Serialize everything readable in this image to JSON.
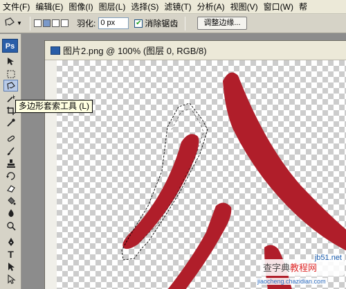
{
  "menubar": {
    "items": [
      "文件(F)",
      "编辑(E)",
      "图像(I)",
      "图层(L)",
      "选择(S)",
      "滤镜(T)",
      "分析(A)",
      "视图(V)",
      "窗口(W)",
      "帮"
    ]
  },
  "options": {
    "feather_label": "羽化:",
    "feather_value": "0 px",
    "antialias_label": "消除锯齿",
    "antialias_checked": true,
    "refine_edge_label": "调整边缘..."
  },
  "toolbox": {
    "logo": "Ps",
    "active_tool": "polygonal-lasso",
    "tools": [
      "move",
      "marquee",
      "polygonal-lasso",
      "quick-selection",
      "crop",
      "eyedropper",
      "healing",
      "brush",
      "clone-stamp",
      "history-brush",
      "eraser",
      "paint-bucket",
      "blur",
      "dodge",
      "pen",
      "type",
      "path-selection",
      "shape"
    ]
  },
  "document": {
    "title": "图片2.png @ 100% (图层 0, RGB/8)"
  },
  "tooltip": {
    "text": "多边形套索工具 (L)"
  },
  "watermark": {
    "prefix": "查字典",
    "highlight": "教程网",
    "url": "jiaocheng.chazidian.com",
    "site_tag": "jb51.net"
  },
  "colors": {
    "artwork_red": "#b01e2a",
    "checker_light": "#ffffff",
    "checker_dark": "#cccccc",
    "ui_bg": "#d6d3c7"
  }
}
